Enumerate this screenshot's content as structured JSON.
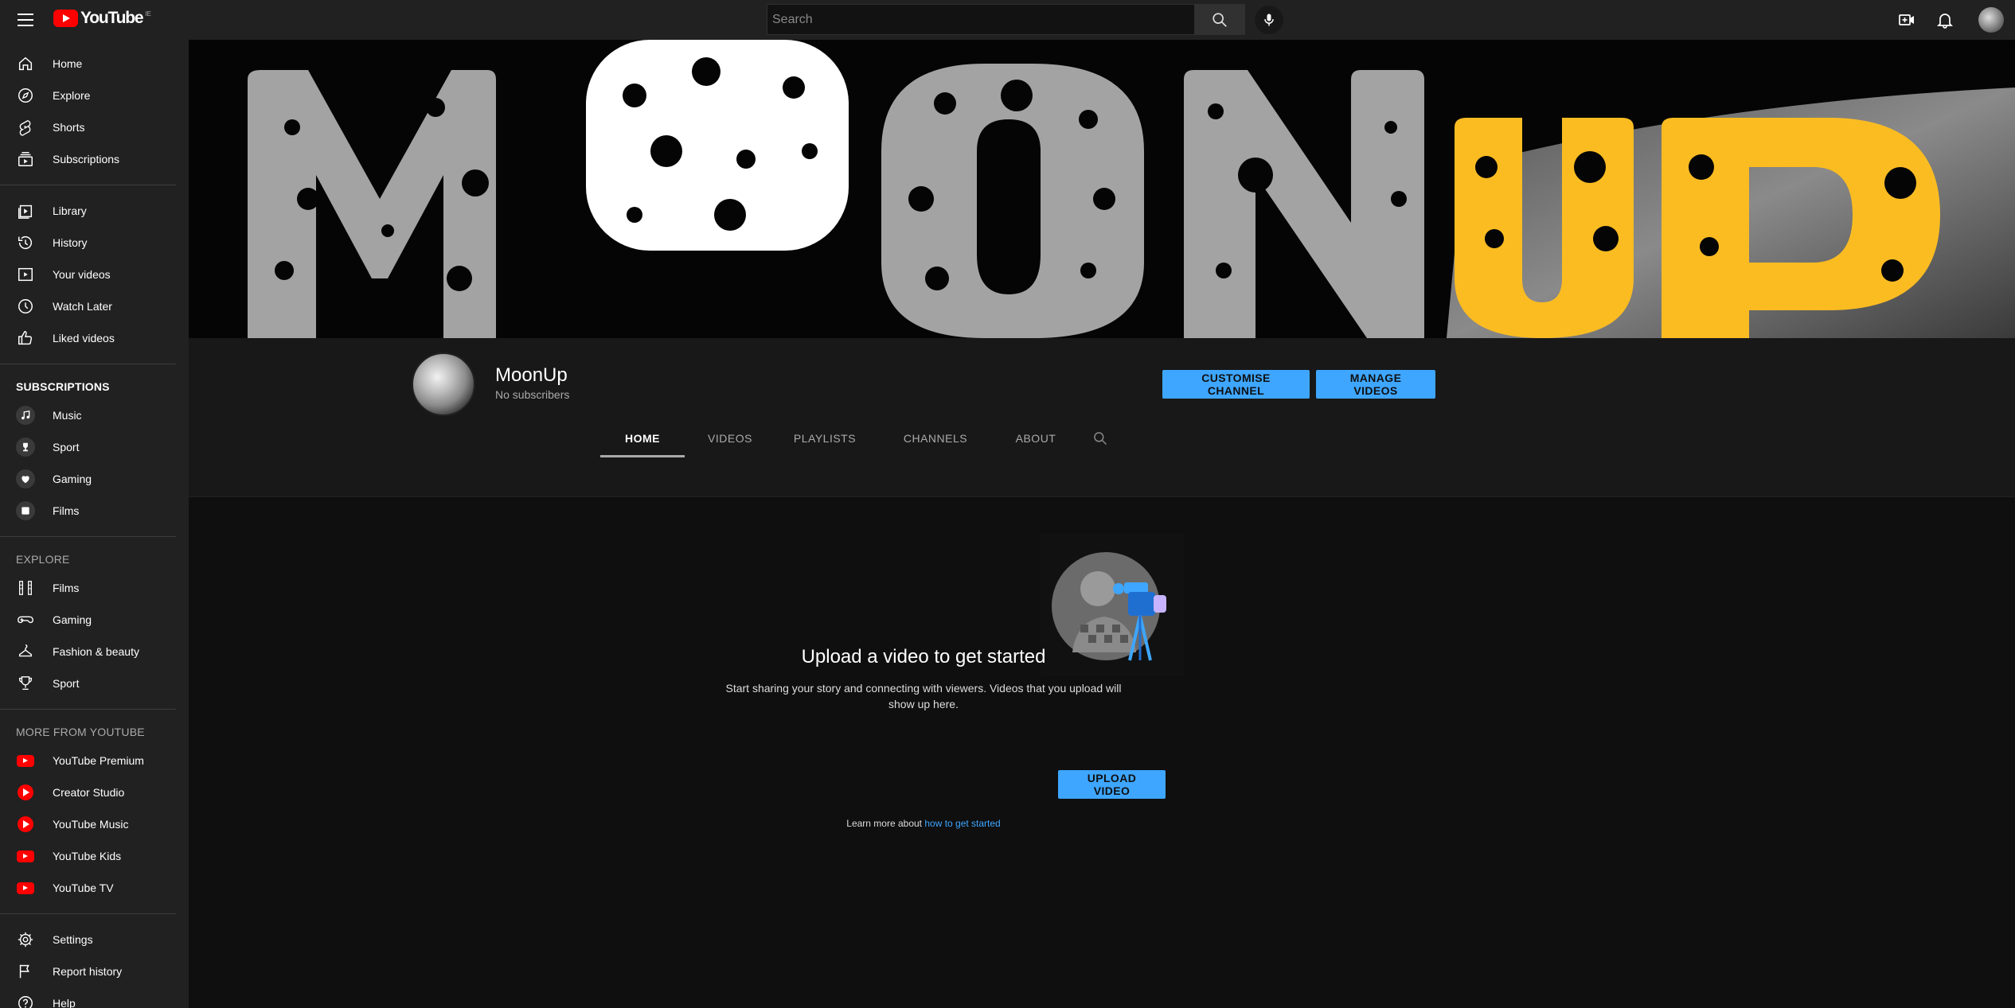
{
  "topbar": {
    "logo_text": "YouTube",
    "country_code": "IE",
    "search_placeholder": "Search"
  },
  "sidebar": {
    "main_items": [
      {
        "label": "Home",
        "icon": "home-icon"
      },
      {
        "label": "Explore",
        "icon": "compass-icon"
      },
      {
        "label": "Shorts",
        "icon": "shorts-icon"
      },
      {
        "label": "Subscriptions",
        "icon": "subscriptions-icon"
      }
    ],
    "library_items": [
      {
        "label": "Library",
        "icon": "library-icon"
      },
      {
        "label": "History",
        "icon": "history-icon"
      },
      {
        "label": "Your videos",
        "icon": "your-videos-icon"
      },
      {
        "label": "Watch Later",
        "icon": "clock-icon"
      },
      {
        "label": "Liked videos",
        "icon": "thumbs-up-icon"
      }
    ],
    "subscriptions_heading": "SUBSCRIPTIONS",
    "subscriptions": [
      {
        "label": "Music",
        "icon": "music-note-icon"
      },
      {
        "label": "Sport",
        "icon": "trophy-icon"
      },
      {
        "label": "Gaming",
        "icon": "gaming-icon"
      },
      {
        "label": "Films",
        "icon": "film-icon"
      }
    ],
    "explore_heading": "EXPLORE",
    "explore": [
      {
        "label": "Films",
        "icon": "film-strip-icon"
      },
      {
        "label": "Gaming",
        "icon": "gamepad-icon"
      },
      {
        "label": "Fashion & beauty",
        "icon": "hanger-icon"
      },
      {
        "label": "Sport",
        "icon": "trophy-icon"
      }
    ],
    "more_heading": "MORE FROM YOUTUBE",
    "more": [
      {
        "label": "YouTube Premium",
        "icon": "youtube-premium-icon"
      },
      {
        "label": "Creator Studio",
        "icon": "creator-studio-icon"
      },
      {
        "label": "YouTube Music",
        "icon": "youtube-music-icon"
      },
      {
        "label": "YouTube Kids",
        "icon": "youtube-kids-icon"
      },
      {
        "label": "YouTube TV",
        "icon": "youtube-tv-icon"
      }
    ],
    "settings_items": [
      {
        "label": "Settings",
        "icon": "gear-icon"
      },
      {
        "label": "Report history",
        "icon": "flag-icon"
      },
      {
        "label": "Help",
        "icon": "help-icon"
      }
    ]
  },
  "banner": {
    "text": "MOONUP"
  },
  "channel": {
    "name": "MoonUp",
    "subscribers": "No subscribers",
    "customise_label": "CUSTOMISE CHANNEL",
    "manage_label": "MANAGE VIDEOS"
  },
  "tabs": [
    {
      "label": "HOME",
      "active": true
    },
    {
      "label": "VIDEOS",
      "active": false
    },
    {
      "label": "PLAYLISTS",
      "active": false
    },
    {
      "label": "CHANNELS",
      "active": false
    },
    {
      "label": "ABOUT",
      "active": false
    }
  ],
  "empty_state": {
    "title": "Upload a video to get started",
    "description": "Start sharing your story and connecting with viewers. Videos that you upload will show up here.",
    "upload_label": "UPLOAD VIDEO",
    "learn_prefix": "Learn more about",
    "learn_link": "how to get started"
  },
  "colors": {
    "accent": "#3ea6ff",
    "brand_red": "#ff0000",
    "banner_yellow": "#fbbc22",
    "banner_grey": "#a3a3a3"
  }
}
